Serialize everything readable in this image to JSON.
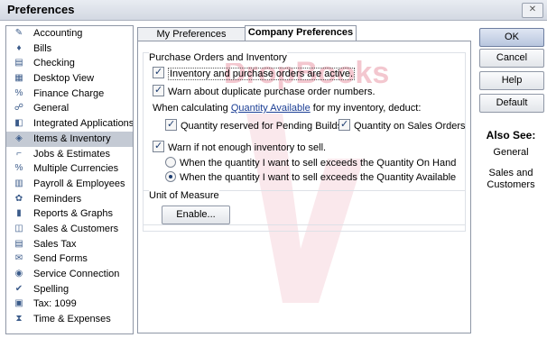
{
  "window": {
    "title": "Preferences",
    "close_label": "✕"
  },
  "sidebar": {
    "items": [
      {
        "label": "Accounting",
        "icon": "accounting-icon",
        "glyph": "✎"
      },
      {
        "label": "Bills",
        "icon": "bills-icon",
        "glyph": "♦"
      },
      {
        "label": "Checking",
        "icon": "checking-icon",
        "glyph": "▤"
      },
      {
        "label": "Desktop View",
        "icon": "desktop-view-icon",
        "glyph": "▦"
      },
      {
        "label": "Finance Charge",
        "icon": "finance-charge-icon",
        "glyph": "%"
      },
      {
        "label": "General",
        "icon": "general-icon",
        "glyph": "☍"
      },
      {
        "label": "Integrated Applications",
        "icon": "integrated-applications-icon",
        "glyph": "◧"
      },
      {
        "label": "Items & Inventory",
        "icon": "items-inventory-icon",
        "glyph": "◈",
        "selected": true
      },
      {
        "label": "Jobs & Estimates",
        "icon": "jobs-estimates-icon",
        "glyph": "⌐"
      },
      {
        "label": "Multiple Currencies",
        "icon": "multiple-currencies-icon",
        "glyph": "%"
      },
      {
        "label": "Payroll & Employees",
        "icon": "payroll-employees-icon",
        "glyph": "▥"
      },
      {
        "label": "Reminders",
        "icon": "reminders-icon",
        "glyph": "✿"
      },
      {
        "label": "Reports & Graphs",
        "icon": "reports-graphs-icon",
        "glyph": "▮"
      },
      {
        "label": "Sales & Customers",
        "icon": "sales-customers-icon",
        "glyph": "◫"
      },
      {
        "label": "Sales Tax",
        "icon": "sales-tax-icon",
        "glyph": "▤"
      },
      {
        "label": "Send Forms",
        "icon": "send-forms-icon",
        "glyph": "✉"
      },
      {
        "label": "Service Connection",
        "icon": "service-connection-icon",
        "glyph": "◉"
      },
      {
        "label": "Spelling",
        "icon": "spelling-icon",
        "glyph": "✔"
      },
      {
        "label": "Tax: 1099",
        "icon": "tax-1099-icon",
        "glyph": "▣"
      },
      {
        "label": "Time & Expenses",
        "icon": "time-expenses-icon",
        "glyph": "⧗"
      }
    ]
  },
  "tabs": {
    "my_prefs": "My Preferences",
    "company_prefs": "Company Preferences"
  },
  "po_group": {
    "title": "Purchase Orders and Inventory",
    "active_label": "Inventory and purchase orders are active.",
    "dup_warn_label": "Warn about duplicate purchase order numbers.",
    "calc_prefix": "When calculating",
    "calc_link": "Quantity Available",
    "calc_suffix": "for my inventory, deduct:",
    "pending_builds_label": "Quantity reserved for Pending Builds",
    "sales_orders_label": "Quantity on Sales Orders",
    "warn_insufficient_label": "Warn if not enough inventory to sell.",
    "radio_on_hand_label": "When the quantity I want to sell exceeds the Quantity On Hand",
    "radio_available_label": "When the quantity I want to sell exceeds the Quantity Available"
  },
  "uom_group": {
    "title": "Unit of Measure",
    "enable_label": "Enable..."
  },
  "buttons": {
    "ok": "OK",
    "cancel": "Cancel",
    "help": "Help",
    "default": "Default"
  },
  "also_see": {
    "title": "Also See:",
    "links": [
      "General",
      "Sales and Customers"
    ]
  },
  "watermark": {
    "text": "DropBooks"
  },
  "colors": {
    "selected_row": "#c4cad4",
    "border": "#8f97a6",
    "watermark": "#f0b8c3"
  }
}
